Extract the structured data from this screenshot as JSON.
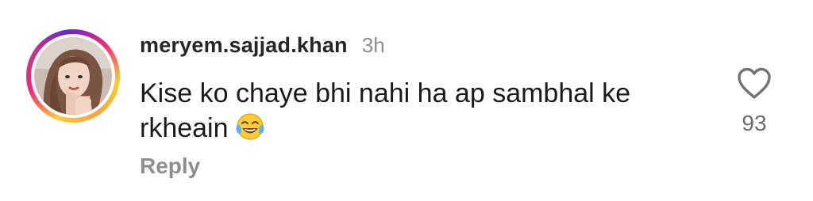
{
  "comment": {
    "username": "meryem.sajjad.khan",
    "timestamp": "3h",
    "text": "Kise ko chaye bhi nahi ha ap sambhal ke rkheain",
    "emoji": "face-with-tears-of-joy",
    "reply_label": "Reply",
    "like_count": "93",
    "like_icon": "heart-outline-icon"
  },
  "colors": {
    "username": "#262626",
    "secondary_text": "#8e8e8e",
    "ring_yellow": "#f9ce34",
    "ring_pink": "#ee2a7b",
    "ring_purple": "#6228d7"
  }
}
